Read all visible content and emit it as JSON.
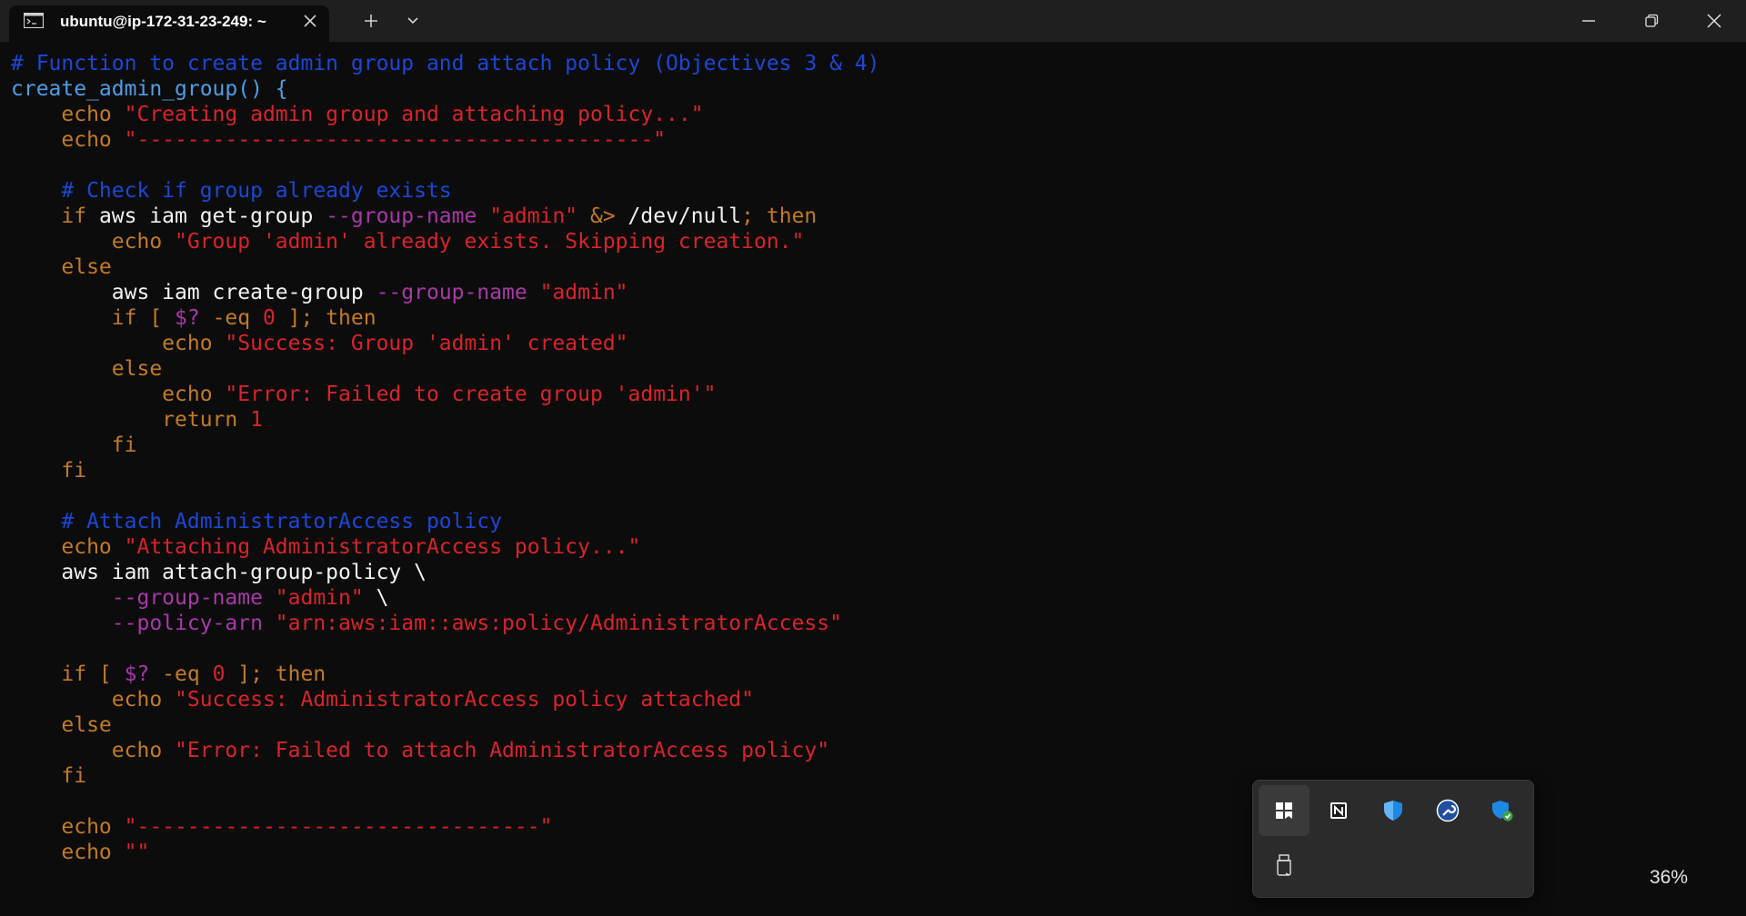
{
  "window": {
    "tab_title": "ubuntu@ip-172-31-23-249: ~",
    "tab_icon": "terminal-icon",
    "new_tab_icon": "plus-icon",
    "dropdown_icon": "chevron-down-icon",
    "controls": [
      "minimize-icon",
      "restore-icon",
      "close-icon"
    ]
  },
  "colors": {
    "background": "#0c0c0c",
    "titlebar": "#1f1f1f",
    "comment": "#1c47d6",
    "function": "#4f9ee6",
    "keyword": "#c37a26",
    "string": "#d8242b",
    "option": "#a839a8",
    "plain": "#f2f2f2"
  },
  "terminal": {
    "lines": [
      [
        {
          "t": "# Function to create admin group and attach policy (Objectives 3 & 4)",
          "c": "comment"
        }
      ],
      [
        {
          "t": "create_admin_group() {",
          "c": "func"
        }
      ],
      [
        {
          "t": "    echo ",
          "c": "kw"
        },
        {
          "t": "\"Creating admin group and attaching policy...\"",
          "c": "str"
        }
      ],
      [
        {
          "t": "    echo ",
          "c": "kw"
        },
        {
          "t": "\"-----------------------------------------\"",
          "c": "str"
        }
      ],
      [],
      [
        {
          "t": "    # Check if group already exists",
          "c": "comment"
        }
      ],
      [
        {
          "t": "    if ",
          "c": "kw"
        },
        {
          "t": "aws iam get-group ",
          "c": "plain"
        },
        {
          "t": "--group-name ",
          "c": "opt"
        },
        {
          "t": "\"admin\" ",
          "c": "str"
        },
        {
          "t": "&> ",
          "c": "kw"
        },
        {
          "t": "/dev/null",
          "c": "plain"
        },
        {
          "t": "; then",
          "c": "kw"
        }
      ],
      [
        {
          "t": "        echo ",
          "c": "kw"
        },
        {
          "t": "\"Group 'admin' already exists. Skipping creation.\"",
          "c": "str"
        }
      ],
      [
        {
          "t": "    else",
          "c": "kw"
        }
      ],
      [
        {
          "t": "        aws iam create-group ",
          "c": "plain"
        },
        {
          "t": "--group-name ",
          "c": "opt"
        },
        {
          "t": "\"admin\"",
          "c": "str"
        }
      ],
      [
        {
          "t": "        if [ ",
          "c": "kw"
        },
        {
          "t": "$? ",
          "c": "opt"
        },
        {
          "t": "-eq ",
          "c": "kw"
        },
        {
          "t": "0",
          "c": "str"
        },
        {
          "t": " ]; then",
          "c": "kw"
        }
      ],
      [
        {
          "t": "            echo ",
          "c": "kw"
        },
        {
          "t": "\"Success: Group 'admin' created\"",
          "c": "str"
        }
      ],
      [
        {
          "t": "        else",
          "c": "kw"
        }
      ],
      [
        {
          "t": "            echo ",
          "c": "kw"
        },
        {
          "t": "\"Error: Failed to create group 'admin'\"",
          "c": "str"
        }
      ],
      [
        {
          "t": "            return ",
          "c": "kw"
        },
        {
          "t": "1",
          "c": "str"
        }
      ],
      [
        {
          "t": "        fi",
          "c": "kw"
        }
      ],
      [
        {
          "t": "    fi",
          "c": "kw"
        }
      ],
      [],
      [
        {
          "t": "    # Attach AdministratorAccess policy",
          "c": "comment"
        }
      ],
      [
        {
          "t": "    echo ",
          "c": "kw"
        },
        {
          "t": "\"Attaching AdministratorAccess policy...\"",
          "c": "str"
        }
      ],
      [
        {
          "t": "    aws iam attach-group-policy \\",
          "c": "plain"
        }
      ],
      [
        {
          "t": "        --group-name ",
          "c": "opt"
        },
        {
          "t": "\"admin\" ",
          "c": "str"
        },
        {
          "t": "\\",
          "c": "plain"
        }
      ],
      [
        {
          "t": "        --policy-arn ",
          "c": "opt"
        },
        {
          "t": "\"arn:aws:iam::aws:policy/AdministratorAccess\"",
          "c": "str"
        }
      ],
      [],
      [
        {
          "t": "    if [ ",
          "c": "kw"
        },
        {
          "t": "$? ",
          "c": "opt"
        },
        {
          "t": "-eq ",
          "c": "kw"
        },
        {
          "t": "0",
          "c": "str"
        },
        {
          "t": " ]; then",
          "c": "kw"
        }
      ],
      [
        {
          "t": "        echo ",
          "c": "kw"
        },
        {
          "t": "\"Success: AdministratorAccess policy attached\"",
          "c": "str"
        }
      ],
      [
        {
          "t": "    else",
          "c": "kw"
        }
      ],
      [
        {
          "t": "        echo ",
          "c": "kw"
        },
        {
          "t": "\"Error: Failed to attach AdministratorAccess policy\"",
          "c": "str"
        }
      ],
      [
        {
          "t": "    fi",
          "c": "kw"
        }
      ],
      [],
      [
        {
          "t": "    echo ",
          "c": "kw"
        },
        {
          "t": "\"--------------------------------\"",
          "c": "str"
        }
      ],
      [
        {
          "t": "    echo ",
          "c": "kw"
        },
        {
          "t": "\"\"",
          "c": "str"
        }
      ]
    ]
  },
  "tray": {
    "icons": [
      "app-grid-icon",
      "notion-icon",
      "defender-shield-icon",
      "wrench-icon",
      "security-shield-check-icon",
      "usb-drive-icon"
    ],
    "zoom": "36%"
  }
}
